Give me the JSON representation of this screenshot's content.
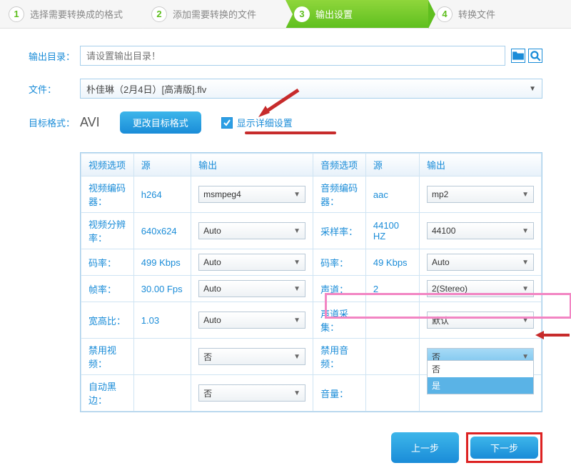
{
  "steps": {
    "s1": "选择需要转换成的格式",
    "s2": "添加需要转换的文件",
    "s3": "输出设置",
    "s4": "转换文件"
  },
  "labels": {
    "outdir": "输出目录：",
    "file": "文件：",
    "fmt": "目标格式："
  },
  "outdir_placeholder": "请设置输出目录！",
  "file_value": "朴佳琳（2月4日）[高清版].flv",
  "fmt_value": "AVI",
  "btn_change_fmt": "更改目标格式",
  "chk_detail": "显示详细设置",
  "table": {
    "headers": {
      "vopt": "视频选项",
      "src": "源",
      "out": "输出",
      "aopt": "音频选项"
    },
    "rows": {
      "vcodec": {
        "lab": "视频编码器：",
        "src": "h264",
        "out": "msmpeg4"
      },
      "vres": {
        "lab": "视频分辨率：",
        "src": "640x624",
        "out": "Auto"
      },
      "vbr": {
        "lab": "码率：",
        "src": "499 Kbps",
        "out": "Auto"
      },
      "vfps": {
        "lab": "帧率：",
        "src": "30.00 Fps",
        "out": "Auto"
      },
      "vratio": {
        "lab": "宽高比：",
        "src": "1.03",
        "out": "Auto"
      },
      "vdis": {
        "lab": "禁用视频：",
        "src": "",
        "out": "否"
      },
      "vpad": {
        "lab": "自动黑边：",
        "src": "",
        "out": "否"
      },
      "acodec": {
        "lab": "音频编码器：",
        "src": "aac",
        "out": "mp2"
      },
      "arate": {
        "lab": "采样率：",
        "src": "44100 HZ",
        "out": "44100"
      },
      "abr": {
        "lab": "码率：",
        "src": "49 Kbps",
        "out": "Auto"
      },
      "ach": {
        "lab": "声道：",
        "src": "2",
        "out": "2(Stereo)"
      },
      "achs": {
        "lab": "声道采集：",
        "src": "",
        "out": "默认"
      },
      "adis": {
        "lab": "禁用音频：",
        "src": "",
        "out": "否"
      },
      "avol": {
        "lab": "音量：",
        "src": "",
        "out": ""
      }
    },
    "drop_opts": {
      "opt0": "否",
      "opt1": "是"
    }
  },
  "btn_prev": "上一步",
  "btn_next": "下一步"
}
